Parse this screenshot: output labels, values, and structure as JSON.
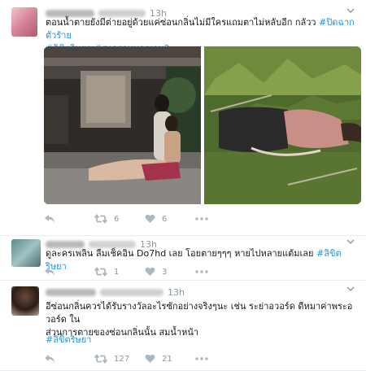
{
  "tweets": [
    {
      "time": "13h",
      "text_plain": "ตอนน้ำตายยังมีต่ายอยู่ด้วยแค่ซ่อนกลิ่นไม่มีใครแถมตาไม่หลับอีก กลัวว ",
      "hashtag1": "#ปิดฉากตัวร้าย",
      "hashtag2": "#ลิขิตริษยา",
      "hashtag3": "#สงครามนางงาม2",
      "retweets": "6",
      "likes": "6"
    },
    {
      "time": "13h",
      "text_plain": "ดูละครเพลิน ลืมเช็คอิน Do7hd เลย โอยตายๆๆๆ หายไปหลายแต้มเลย ",
      "hashtag1": "#ลิขิตริษยา",
      "retweets": "1",
      "likes": "3"
    },
    {
      "time": "13h",
      "text_line1": "อีซ่อนกลิ่นควรได้รับรางวัลอะไรซักอย่างจริงๆนะ เช่น ระย่าอวอร์ด ดีหมาค่าพระอวอร์ด ใน",
      "text_line2": "ส่วนการตายของซ่อนกลิ่นนั้น สมน้ำหน้า",
      "hashtag1": "#ลิขิตริษยา",
      "retweets": "127",
      "likes": "21"
    }
  ],
  "icons": {
    "reply": "reply-icon",
    "retweet": "retweet-icon",
    "like": "heart-icon",
    "more": "more-icon",
    "caret": "chevron-down-icon"
  },
  "colors": {
    "hashtag": "#1b95e0",
    "meta": "#8899a6",
    "divider": "#e6ecf0"
  }
}
